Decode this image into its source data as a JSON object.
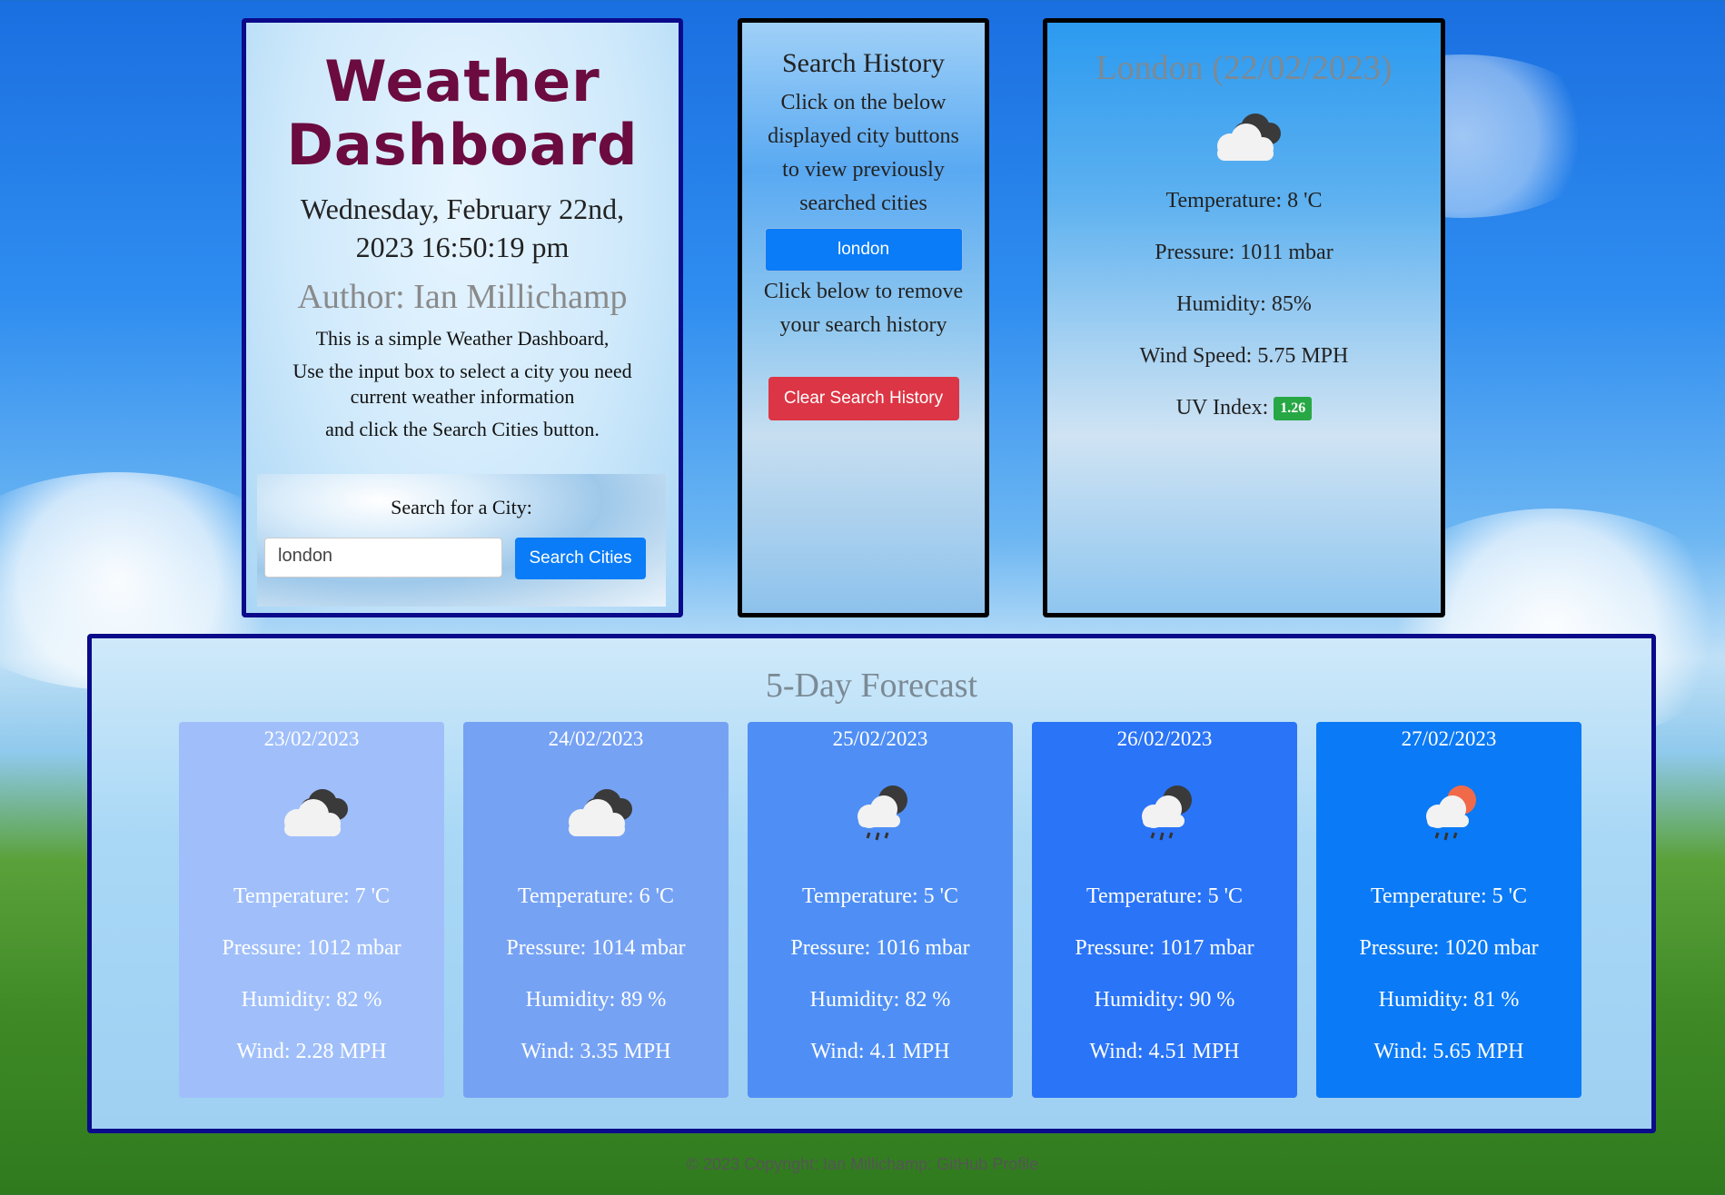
{
  "intro": {
    "title_line1": "Weather",
    "title_line2": "Dashboard",
    "date_line1": "Wednesday, February 22nd,",
    "date_line2": "2023 16:50:19 pm",
    "author": "Author: Ian Millichamp",
    "desc1": "This is a simple Weather Dashboard,",
    "desc2": "Use the input box to select a city you need current weather information",
    "desc3": "and click the Search Cities button.",
    "search_label": "Search for a City:",
    "search_value": "london",
    "search_button": "Search Cities"
  },
  "history": {
    "title": "Search History",
    "instructions": "Click on the below displayed city buttons to view previously searched cities",
    "cities": [
      "london"
    ],
    "remove_text": "Click below to remove your search history",
    "clear_button": "Clear Search History"
  },
  "current": {
    "title": "London (22/02/2023)",
    "icon": "overcast-clouds-icon",
    "temperature": "Temperature: 8 'C",
    "pressure": "Pressure: 1011 mbar",
    "humidity": "Humidity: 85%",
    "wind": "Wind Speed: 5.75 MPH",
    "uv_label": "UV Index:",
    "uv_value": "1.26",
    "uv_color": "#28a745"
  },
  "forecast": {
    "title": "5-Day Forecast",
    "days": [
      {
        "date": "23/02/2023",
        "icon": "overcast-clouds-icon",
        "temp": "Temperature: 7 'C",
        "pressure": "Pressure: 1012 mbar",
        "humidity": "Humidity: 82 %",
        "wind": "Wind: 2.28 MPH",
        "bg": "#a0bffa"
      },
      {
        "date": "24/02/2023",
        "icon": "overcast-clouds-icon",
        "temp": "Temperature: 6 'C",
        "pressure": "Pressure: 1014 mbar",
        "humidity": "Humidity: 89 %",
        "wind": "Wind: 3.35 MPH",
        "bg": "#76a2f4"
      },
      {
        "date": "25/02/2023",
        "icon": "rain-night-icon",
        "temp": "Temperature: 5 'C",
        "pressure": "Pressure: 1016 mbar",
        "humidity": "Humidity: 82 %",
        "wind": "Wind: 4.1 MPH",
        "bg": "#4f8ff5"
      },
      {
        "date": "26/02/2023",
        "icon": "rain-night-icon",
        "temp": "Temperature: 5 'C",
        "pressure": "Pressure: 1017 mbar",
        "humidity": "Humidity: 90 %",
        "wind": "Wind: 4.51 MPH",
        "bg": "#2a74f7"
      },
      {
        "date": "27/02/2023",
        "icon": "rain-sun-icon",
        "temp": "Temperature: 5 'C",
        "pressure": "Pressure: 1020 mbar",
        "humidity": "Humidity: 81 %",
        "wind": "Wind: 5.65 MPH",
        "bg": "#0b7af6"
      }
    ]
  },
  "footer": "© 2023 Copyright: Ian Millichamp: GitHub Profile"
}
